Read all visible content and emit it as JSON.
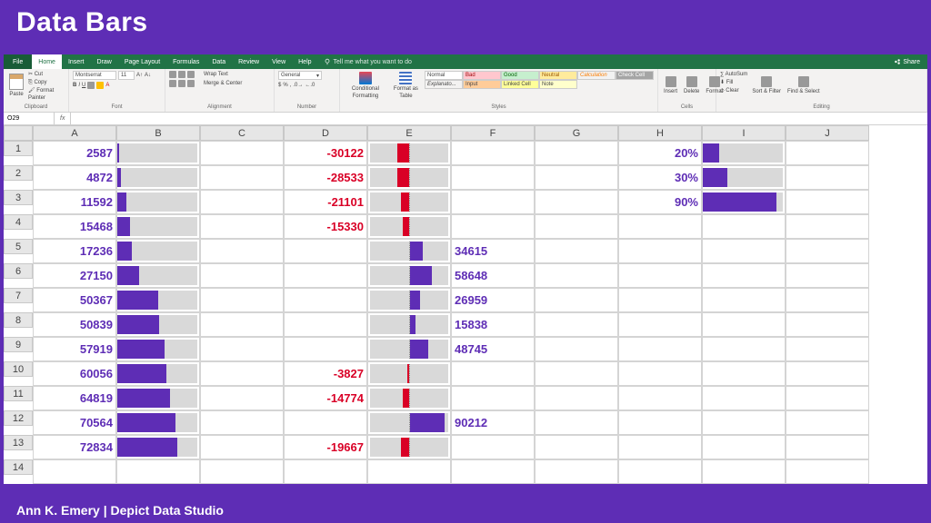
{
  "banner": {
    "title": "Data Bars"
  },
  "footer": {
    "text": "Ann K. Emery | Depict Data Studio"
  },
  "menubar": {
    "file": "File",
    "tabs": [
      "Home",
      "Insert",
      "Draw",
      "Page Layout",
      "Formulas",
      "Data",
      "Review",
      "View",
      "Help"
    ],
    "active": "Home",
    "tell_me": "Tell me what you want to do",
    "share": "Share"
  },
  "ribbon": {
    "clipboard": {
      "label": "Clipboard",
      "paste": "Paste",
      "cut": "Cut",
      "copy": "Copy",
      "fp": "Format Painter"
    },
    "font": {
      "label": "Font",
      "name": "Montserrat",
      "size": "11"
    },
    "alignment": {
      "label": "Alignment",
      "wrap": "Wrap Text",
      "merge": "Merge & Center"
    },
    "number": {
      "label": "Number",
      "fmt": "General"
    },
    "styles": {
      "label": "Styles",
      "cf": "Conditional Formatting",
      "fat": "Format as Table",
      "cells": [
        "Normal",
        "Bad",
        "Good",
        "Neutral",
        "Calculation",
        "Check Cell",
        "Explanato...",
        "Input",
        "Linked Cell",
        "Note"
      ]
    },
    "cells": {
      "label": "Cells",
      "insert": "Insert",
      "delete": "Delete",
      "format": "Format"
    },
    "editing": {
      "label": "Editing",
      "autosum": "AutoSum",
      "fill": "Fill",
      "clear": "Clear",
      "sort": "Sort & Filter",
      "find": "Find & Select"
    }
  },
  "formula_bar": {
    "namebox": "O29",
    "fx": "fx"
  },
  "grid": {
    "columns": [
      "A",
      "B",
      "C",
      "D",
      "E",
      "F",
      "G",
      "H",
      "I",
      "J"
    ],
    "rows": 14
  },
  "chart_data": {
    "type": "bar",
    "series": [
      {
        "name": "A_values",
        "column": "A",
        "color": "#5e2db5",
        "bar_column": "B",
        "max": 100000,
        "values": [
          2587,
          4872,
          11592,
          15468,
          17236,
          27150,
          50367,
          50839,
          57919,
          60056,
          64819,
          70564,
          72834
        ]
      },
      {
        "name": "D_posneg",
        "column": "D",
        "bar_column": "E",
        "pos_color": "#5e2db5",
        "neg_color": "#d90026",
        "abs_max": 100000,
        "values": [
          -30122,
          -28533,
          -21101,
          -15330,
          34615,
          58648,
          26959,
          15838,
          48745,
          -3827,
          -14774,
          90212,
          -19667
        ]
      },
      {
        "name": "F_overflow",
        "column": "F",
        "display_rows": [
          5,
          6,
          7,
          8,
          9,
          12
        ],
        "values": [
          34615,
          58648,
          26959,
          15838,
          48745,
          90212
        ]
      },
      {
        "name": "H_percent",
        "column": "H",
        "bar_column": "I",
        "color": "#5e2db5",
        "max": 1.0,
        "values": [
          0.2,
          0.3,
          0.9
        ],
        "labels": [
          "20%",
          "30%",
          "90%"
        ]
      }
    ]
  }
}
